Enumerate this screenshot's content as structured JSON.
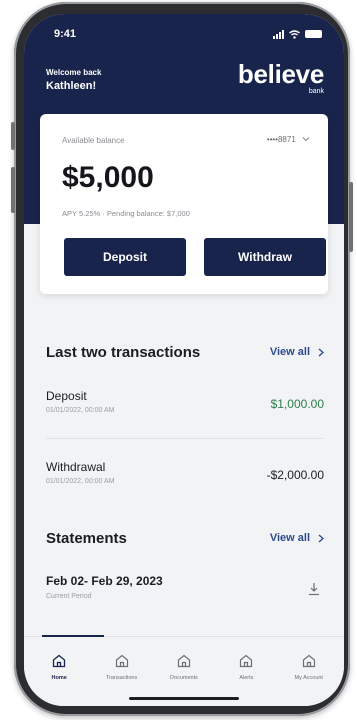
{
  "status_bar": {
    "time": "9:41"
  },
  "header": {
    "welcome_line": "Welcome back",
    "user_name": "Kathleen!",
    "brand_name": "believe",
    "brand_sub": "bank"
  },
  "balance_card": {
    "available_label": "Available balance",
    "account_mask": "••••8871",
    "balance": "$5,000",
    "apy_line": "APY 5.25%  ·  Pending balance: $7,000",
    "deposit_label": "Deposit",
    "withdraw_label": "Withdraw"
  },
  "transactions": {
    "title": "Last two transactions",
    "view_all": "View all",
    "items": [
      {
        "name": "Deposit",
        "date": "01/01/2022, 00:00 AM",
        "amount": "$1,000.00",
        "color": "#2e7d4f"
      },
      {
        "name": "Withdrawal",
        "date": "01/01/2022, 00:00 AM",
        "amount": "-$2,000.00",
        "color": "#1b1d22"
      }
    ]
  },
  "statements": {
    "title": "Statements",
    "view_all": "View all",
    "item": {
      "name": "Feb 02- Feb 29, 2023",
      "sub": "Current Period"
    }
  },
  "tabbar": {
    "items": [
      {
        "label": "Home",
        "icon": "home-icon",
        "active": true
      },
      {
        "label": "Transactions",
        "icon": "home-icon"
      },
      {
        "label": "Documents",
        "icon": "home-icon"
      },
      {
        "label": "Alerts",
        "icon": "home-icon"
      },
      {
        "label": "My Account",
        "icon": "home-icon"
      }
    ]
  },
  "colors": {
    "brand_navy": "#19244d",
    "link_blue": "#2f4a8c",
    "positive_green": "#2e7d4f"
  }
}
